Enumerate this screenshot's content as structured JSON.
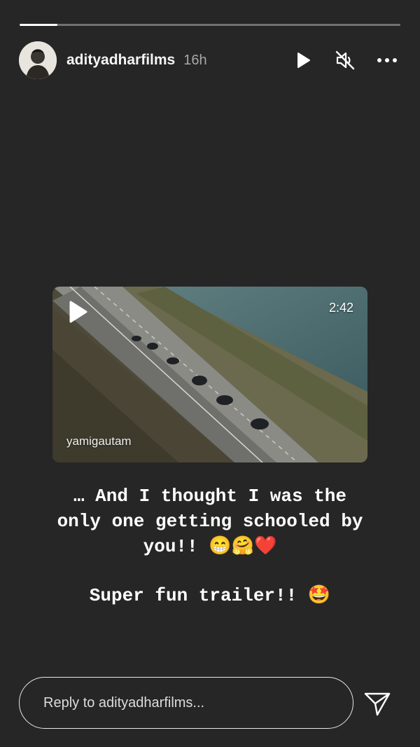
{
  "story": {
    "progress": 0.1,
    "user": {
      "username": "adityadharfilms",
      "time": "16h",
      "avatar": "avatar-photo"
    },
    "controls": {
      "play_icon": "play-icon",
      "mute_icon": "muted-speaker-icon",
      "more_icon": "more-horizontal-icon"
    },
    "video": {
      "duration": "2:42",
      "credit": "yamigautam",
      "play_icon": "play-icon"
    },
    "caption": {
      "line1": "… And I thought I was the\nonly one getting schooled by\nyou!! 😁🤗❤️",
      "line2": "Super fun trailer!! 🤩"
    },
    "reply": {
      "placeholder": "Reply to adityadharfilms...",
      "send_icon": "send-paper-plane-icon"
    }
  },
  "colors": {
    "background": "#262626",
    "text": "#ffffff",
    "muted": "#a8a8a8"
  }
}
